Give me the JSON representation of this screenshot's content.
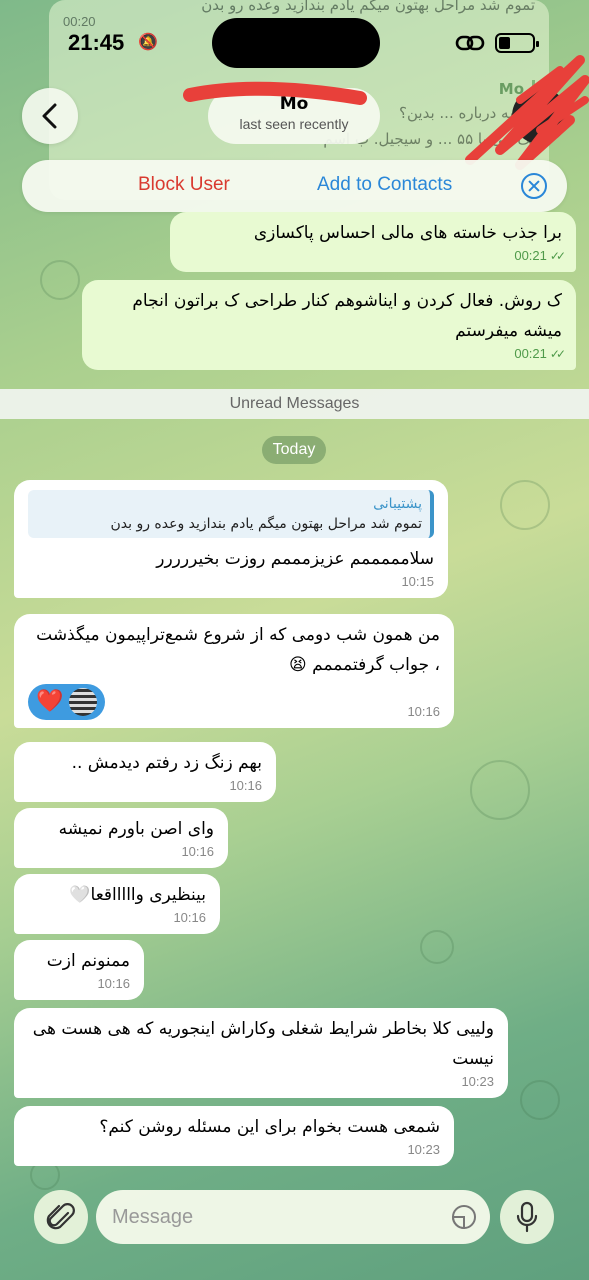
{
  "status_bar": {
    "time": "21:45"
  },
  "background_messages": {
    "top_text": "تموم شد مراحل بهتون میگم یادم بندازید وعده رو بدن",
    "top_time": "00:20",
    "quote_name": "Mo",
    "quote_text": "میشه درباره ... بدین؟",
    "line_text": "یک ینی با ۵۵ ... و سیجیل. ب اسم"
  },
  "header": {
    "name": "Mo",
    "subtitle": "last seen recently"
  },
  "action_bar": {
    "block_label": "Block User",
    "add_label": "Add to Contacts"
  },
  "messages_out": [
    {
      "text": "برا جذب خاسته های مالی احساس پاکسازی",
      "time": "00:21"
    },
    {
      "text": "ک روش. فعال کردن و ایناشوهم کنار طراحی ک براتون انجام میشه میفرستم",
      "time": "00:21"
    }
  ],
  "unread_label": "Unread Messages",
  "date_label": "Today",
  "messages_in": [
    {
      "reply_name": "پشتیبانی",
      "reply_text": "تموم شد مراحل بهتون میگم یادم بندازید وعده رو بدن",
      "text": "سلامممممم عزیزمممم روزت بخیررررر",
      "time": "10:15"
    },
    {
      "text": "من همون شب دومی که از شروع شمع‌تراپیمون میگذشت ، جواب گرفتمممم 😫",
      "reaction": "❤️",
      "time": "10:16"
    },
    {
      "text": "بهم زنگ زد رفتم دیدمش ..",
      "time": "10:16"
    },
    {
      "text": "وای اصن باورم نمیشه",
      "time": "10:16"
    },
    {
      "text": "بینظیری واااااقعا🤍",
      "time": "10:16"
    },
    {
      "text": "ممنونم ازت",
      "time": "10:16"
    },
    {
      "text": "ولییی کلا بخاطر شرایط شغلی وکاراش اینجوریه که هی هست هی نیست",
      "time": "10:23"
    },
    {
      "text": "شمعی هست بخوام برای این مسئله روشن کنم؟",
      "time": "10:23"
    }
  ],
  "composer": {
    "placeholder": "Message"
  },
  "colors": {
    "outgoing_bubble": "#e8fad2",
    "incoming_bubble": "#ffffff",
    "accent_blue": "#2a87d8",
    "danger_red": "#d93a2f"
  }
}
